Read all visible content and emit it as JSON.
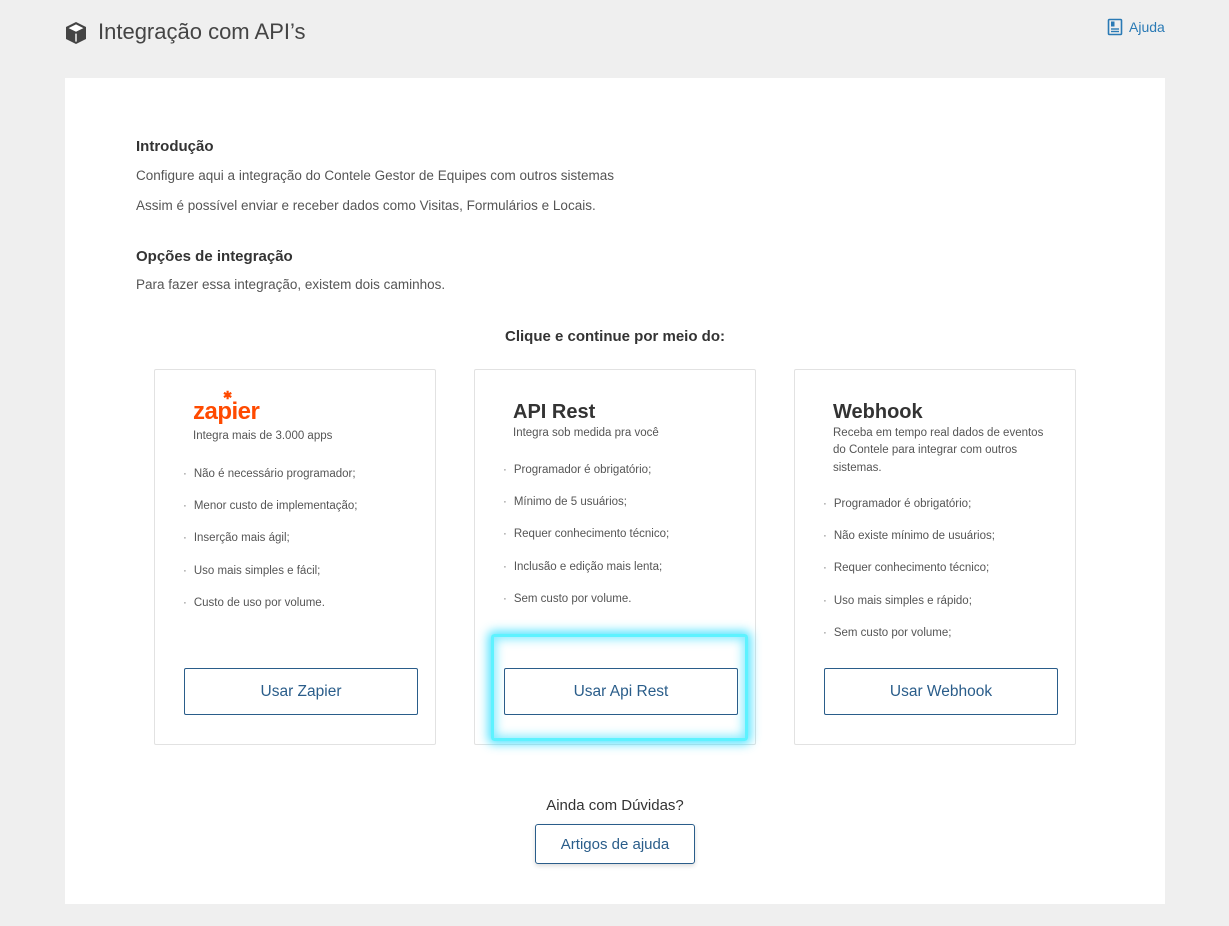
{
  "header": {
    "title": "Integração com API’s",
    "title_icon": "cube-icon",
    "help_label": "Ajuda",
    "help_icon": "document-icon"
  },
  "intro": {
    "title": "Introdução",
    "line1": "Configure aqui a integração do Contele Gestor de Equipes com outros sistemas",
    "line2": "Assim é possível enviar e receber dados como Visitas, Formulários e Locais."
  },
  "options": {
    "title": "Opções de integração",
    "text": "Para fazer essa integração, existem dois caminhos."
  },
  "prompt": "Clique e continue por meio do:",
  "cards": [
    {
      "brand": "zapier",
      "subtitle": "Integra mais de 3.000 apps",
      "items": [
        "Não é necessário programador;",
        "Menor custo de implementação;",
        "Inserção mais ágil;",
        "Uso mais simples e fácil;",
        "Custo de uso por volume."
      ],
      "button": "Usar Zapier"
    },
    {
      "brand": "API Rest",
      "subtitle": "Integra sob medida pra você",
      "items": [
        "Programador é obrigatório;",
        "Mínimo de 5 usuários;",
        "Requer conhecimento técnico;",
        "Inclusão e edição mais lenta;",
        "Sem custo por volume."
      ],
      "button": "Usar Api Rest"
    },
    {
      "brand": "Webhook",
      "subtitle": "Receba em tempo real dados de eventos do Contele para integrar com outros sistemas.",
      "items": [
        "Programador é obrigatório;",
        "Não existe mínimo de usuários;",
        "Requer conhecimento técnico;",
        "Uso mais simples e rápido;",
        "Sem custo por volume;"
      ],
      "button": "Usar Webhook"
    }
  ],
  "footer": {
    "question": "Ainda com Dúvidas?",
    "button": "Artigos de ajuda"
  },
  "colors": {
    "accent": "#2a5d8a",
    "link": "#2a7ab5",
    "zapier": "#ff4a00",
    "highlight": "#5ef2ff"
  }
}
